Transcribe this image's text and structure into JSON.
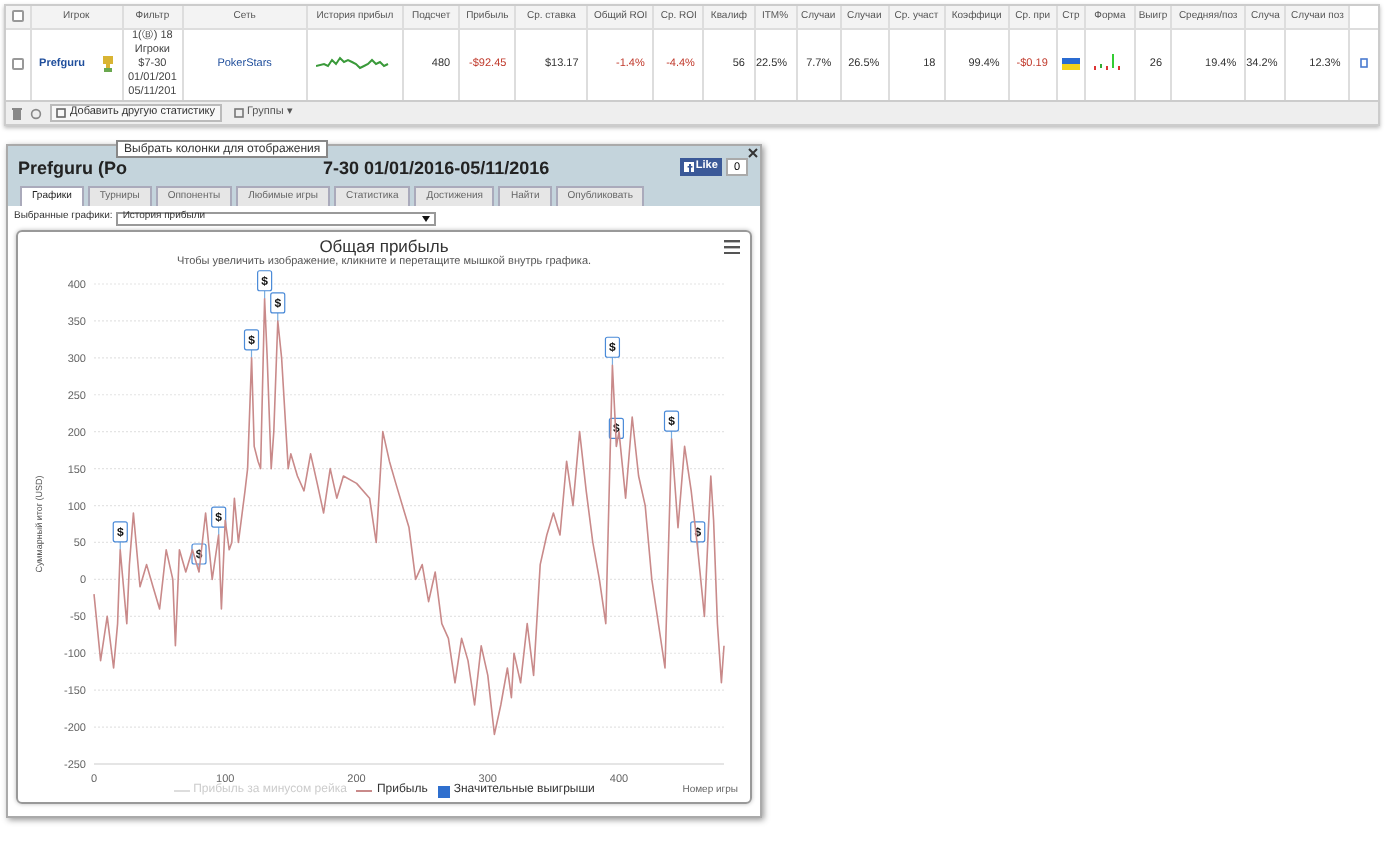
{
  "table": {
    "all_checked": false,
    "columns": [
      "Игрок",
      "Фильтр",
      "Сеть",
      "История прибыл",
      "Подсчет",
      "Прибыль",
      "Ср. ставка",
      "Общий ROI",
      "Ср. ROI",
      "Квалиф",
      "ITM%",
      "Случаи",
      "Случаи",
      "Ср. участ",
      "Коэффици",
      "Ср. при",
      "Стр",
      "Форма",
      "Выигр",
      "Средняя/поз",
      "Случа",
      "Случаи поз"
    ],
    "rows": [
      {
        "checked": false,
        "cells": [
          {
            "kind": "player",
            "text": "Prefguru"
          },
          {
            "kind": "filter",
            "lines": [
              "1(Ⓑ) 18",
              "Игроки",
              "$7-30",
              "01/01/201",
              "05/11/201"
            ]
          },
          {
            "kind": "link",
            "text": "PokerStars"
          },
          {
            "kind": "sparkline"
          },
          {
            "kind": "num",
            "text": "480",
            "negative": false
          },
          {
            "kind": "num",
            "text": "-$92.45",
            "negative": true
          },
          {
            "kind": "num",
            "text": "$13.17",
            "negative": false
          },
          {
            "kind": "num",
            "text": "-1.4%",
            "negative": true
          },
          {
            "kind": "num",
            "text": "-4.4%",
            "negative": true
          },
          {
            "kind": "num",
            "text": "56",
            "negative": false
          },
          {
            "kind": "num",
            "text": "22.5%",
            "negative": false
          },
          {
            "kind": "num",
            "text": "7.7%",
            "negative": false
          },
          {
            "kind": "num",
            "text": "26.5%",
            "negative": false
          },
          {
            "kind": "num",
            "text": "18",
            "negative": false
          },
          {
            "kind": "num",
            "text": "99.4%",
            "negative": false
          },
          {
            "kind": "num",
            "text": "-$0.19",
            "negative": true
          },
          {
            "kind": "flag"
          },
          {
            "kind": "form"
          },
          {
            "kind": "num",
            "text": "26",
            "negative": false
          },
          {
            "kind": "num",
            "text": "19.4%",
            "negative": false
          },
          {
            "kind": "num",
            "text": "34.2%",
            "negative": false
          },
          {
            "kind": "num",
            "text": "12.3%",
            "negative": false
          }
        ]
      }
    ]
  },
  "toolbar": {
    "add_button": "Добавить другую статистику",
    "groups": "Группы ▾"
  },
  "tooltip": "Выбрать колонки для отображения",
  "panel": {
    "title_start": "Prefguru (Po",
    "title_end": "7-30 01/01/2016-05/11/2016",
    "like": "Like",
    "like_count": "0",
    "tabs": [
      {
        "label": "Графики",
        "selected": true
      },
      {
        "label": "Турниры",
        "selected": false
      },
      {
        "label": "Оппоненты",
        "selected": false
      },
      {
        "label": "Любимые игры",
        "selected": false
      },
      {
        "label": "Статистика",
        "selected": false
      },
      {
        "label": "Достижения",
        "selected": false
      },
      {
        "label": "Найти",
        "selected": false
      },
      {
        "label": "Опубликовать",
        "selected": false
      }
    ],
    "chart_select": {
      "label": "Выбранные графики:",
      "value": "История прибыли"
    },
    "chart_subtitle": "Чтобы увеличить изображение, кликните и перетащите мышкой внутрь графика.",
    "legend": [
      {
        "label": "Прибыль за минусом рейка",
        "kind": "line",
        "disabled": true
      },
      {
        "kind": "series",
        "disabled": false
      },
      {
        "label": "Значительные выигрыши",
        "kind": "flag",
        "disabled": false
      }
    ],
    "chart_data": {
      "type": "line",
      "title": "Общая прибыль",
      "xlabel": "Номер игры",
      "ylabel": "Суммарный итог (USD)",
      "grid": true,
      "xlim": [
        0,
        480
      ],
      "ylim": [
        -250,
        400
      ],
      "xticks": [
        0,
        100,
        200,
        300,
        400
      ],
      "yticks": [
        -250,
        -200,
        -150,
        -100,
        -50,
        0,
        50,
        100,
        150,
        200,
        250,
        300,
        350,
        400
      ],
      "x": [
        0,
        5,
        10,
        15,
        18,
        20,
        25,
        27,
        30,
        35,
        40,
        45,
        50,
        55,
        60,
        62,
        65,
        70,
        75,
        80,
        85,
        90,
        95,
        97,
        100,
        103,
        105,
        107,
        110,
        115,
        117,
        120,
        122,
        125,
        127,
        130,
        132,
        135,
        137,
        140,
        143,
        148,
        150,
        155,
        160,
        165,
        170,
        175,
        180,
        185,
        190,
        200,
        210,
        215,
        220,
        225,
        230,
        240,
        245,
        250,
        255,
        260,
        265,
        270,
        275,
        280,
        285,
        290,
        295,
        300,
        305,
        310,
        315,
        318,
        320,
        325,
        330,
        335,
        340,
        345,
        350,
        355,
        360,
        365,
        370,
        375,
        380,
        385,
        390,
        395,
        398,
        400,
        405,
        410,
        415,
        420,
        425,
        430,
        435,
        440,
        445,
        450,
        455,
        460,
        465,
        470,
        472,
        475,
        478,
        480
      ],
      "series": [
        {
          "name": "Прибыль",
          "color": "#c98a8a",
          "values": [
            -20,
            -110,
            -50,
            -120,
            -60,
            40,
            -60,
            20,
            90,
            -10,
            20,
            -10,
            -40,
            40,
            0,
            -90,
            40,
            10,
            40,
            10,
            90,
            0,
            60,
            -40,
            80,
            40,
            50,
            110,
            50,
            120,
            150,
            300,
            180,
            160,
            150,
            380,
            300,
            150,
            200,
            350,
            300,
            150,
            170,
            140,
            120,
            170,
            130,
            90,
            150,
            110,
            140,
            130,
            110,
            50,
            200,
            160,
            130,
            70,
            0,
            20,
            -30,
            10,
            -60,
            -80,
            -140,
            -80,
            -110,
            -170,
            -90,
            -130,
            -210,
            -170,
            -120,
            -160,
            -100,
            -140,
            -60,
            -130,
            20,
            60,
            90,
            60,
            160,
            100,
            200,
            120,
            50,
            0,
            -60,
            290,
            180,
            200,
            110,
            220,
            140,
            100,
            0,
            -60,
            -120,
            190,
            70,
            180,
            120,
            40,
            -50,
            140,
            80,
            -60,
            -140,
            -90
          ]
        }
      ],
      "annotations": [
        {
          "x": 20,
          "text": "$"
        },
        {
          "x": 80,
          "text": "$"
        },
        {
          "x": 95,
          "text": "$"
        },
        {
          "x": 120,
          "text": "$"
        },
        {
          "x": 130,
          "text": "$"
        },
        {
          "x": 140,
          "text": "$"
        },
        {
          "x": 395,
          "text": "$"
        },
        {
          "x": 398,
          "text": "$"
        },
        {
          "x": 440,
          "text": "$"
        },
        {
          "x": 460,
          "text": "$"
        }
      ]
    }
  }
}
